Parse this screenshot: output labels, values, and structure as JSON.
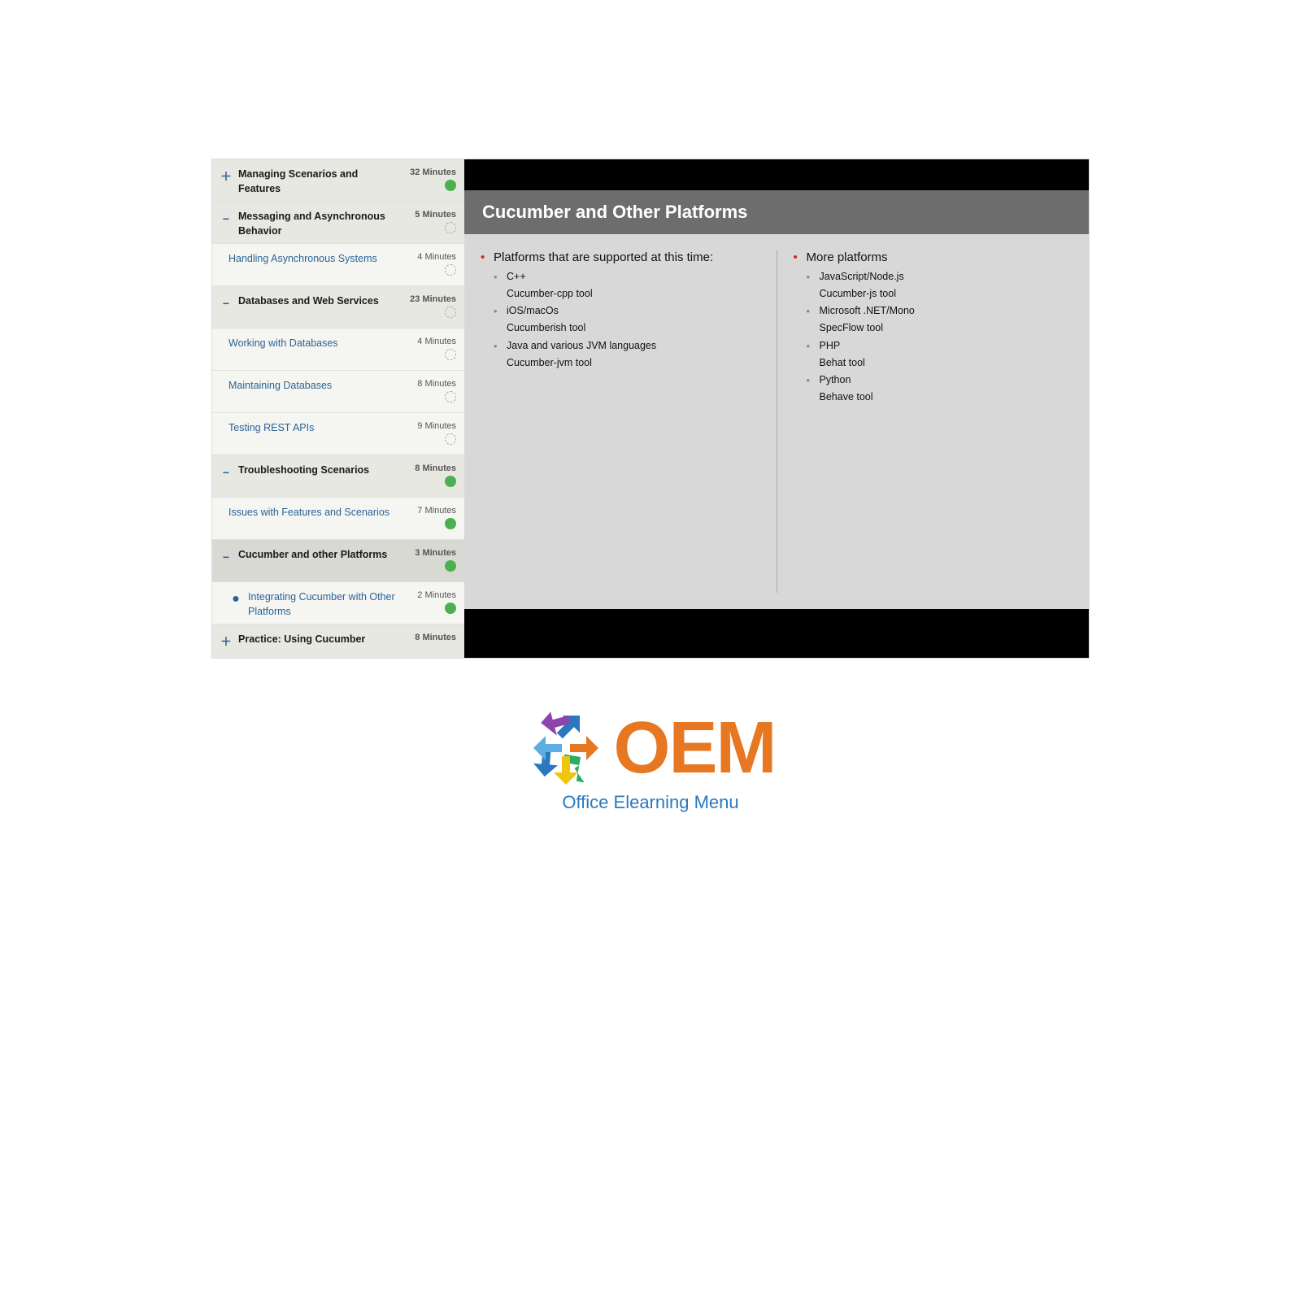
{
  "player": {
    "sidebar": {
      "items": [
        {
          "id": "managing",
          "type": "parent",
          "icon": "plus",
          "label": "Managing Scenarios and Features",
          "duration": "32 Minutes",
          "status": "green"
        },
        {
          "id": "messaging",
          "type": "parent",
          "icon": "minus",
          "label": "Messaging and Asynchronous Behavior",
          "duration": "5 Minutes",
          "status": "dot"
        },
        {
          "id": "handling-async",
          "type": "child",
          "icon": "",
          "label": "Handling Asynchronous Systems",
          "duration": "4 Minutes",
          "status": "dot"
        },
        {
          "id": "databases",
          "type": "parent",
          "icon": "minus",
          "label": "Databases and Web Services",
          "duration": "23 Minutes",
          "status": "dot"
        },
        {
          "id": "working-db",
          "type": "child",
          "icon": "",
          "label": "Working with Databases",
          "duration": "4 Minutes",
          "status": "dot"
        },
        {
          "id": "maintaining-db",
          "type": "child",
          "icon": "",
          "label": "Maintaining Databases",
          "duration": "8 Minutes",
          "status": "dot"
        },
        {
          "id": "testing-rest",
          "type": "child",
          "icon": "",
          "label": "Testing REST APIs",
          "duration": "9 Minutes",
          "status": "dot"
        },
        {
          "id": "troubleshooting",
          "type": "parent",
          "icon": "minus",
          "label": "Troubleshooting Scenarios",
          "duration": "8 Minutes",
          "status": "green"
        },
        {
          "id": "issues",
          "type": "child",
          "icon": "",
          "label": "Issues with Features and Scenarios",
          "duration": "7 Minutes",
          "status": "green"
        },
        {
          "id": "cucumber-platforms",
          "type": "parent",
          "icon": "minus",
          "label": "Cucumber and other Platforms",
          "duration": "3 Minutes",
          "status": "green",
          "active": true
        },
        {
          "id": "integrating",
          "type": "child-avatar",
          "icon": "avatar",
          "label": "Integrating Cucumber with Other Platforms",
          "duration": "2 Minutes",
          "status": "green"
        },
        {
          "id": "practice",
          "type": "parent",
          "icon": "plus",
          "label": "Practice: Using Cucumber",
          "duration": "8 Minutes",
          "status": ""
        }
      ]
    },
    "slide": {
      "title": "Cucumber and Other Platforms",
      "left_column": {
        "intro": "Platforms that are supported at this time:",
        "items": [
          {
            "label": "C++",
            "sub": [
              "Cucumber-cpp tool"
            ]
          },
          {
            "label": "iOS/macOs",
            "sub": [
              "Cucumberish tool"
            ]
          },
          {
            "label": "Java and various JVM languages",
            "sub": [
              "Cucumber-jvm tool"
            ]
          }
        ]
      },
      "right_column": {
        "intro": "More platforms",
        "items": [
          {
            "label": "JavaScript/Node.js",
            "sub": [
              "Cucumber-js tool"
            ]
          },
          {
            "label": "Microsoft .NET/Mono",
            "sub": [
              "SpecFlow tool"
            ]
          },
          {
            "label": "PHP",
            "sub": [
              "Behat tool"
            ]
          },
          {
            "label": "Python",
            "sub": [
              "Behave tool"
            ]
          }
        ]
      }
    }
  },
  "logo": {
    "brand": "OEM",
    "tagline": "Office Elearning Menu"
  }
}
